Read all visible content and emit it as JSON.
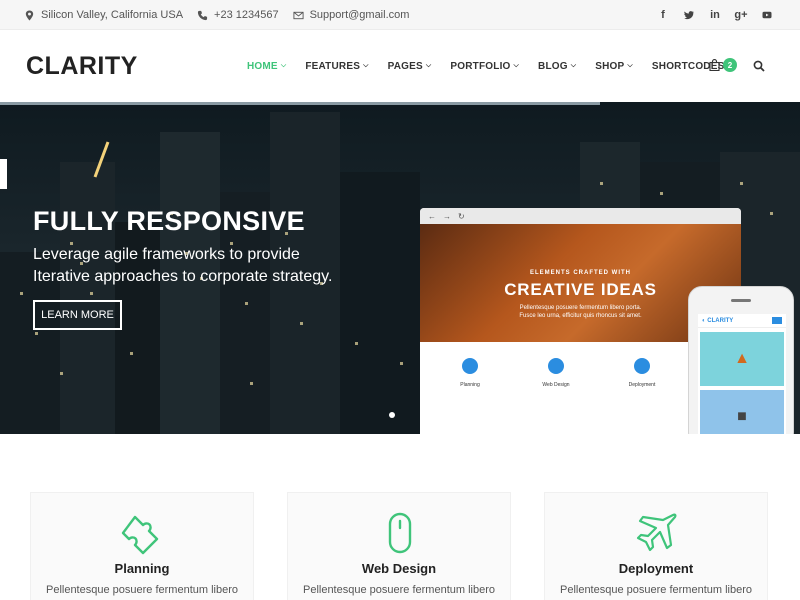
{
  "topbar": {
    "location": "Silicon Valley, California USA",
    "phone": "+23 1234567",
    "email": "Support@gmail.com",
    "social": [
      "facebook-icon",
      "twitter-icon",
      "linkedin-icon",
      "google-plus-icon",
      "youtube-icon"
    ]
  },
  "header": {
    "logo": "CLARITY",
    "nav": [
      {
        "label": "HOME",
        "active": true
      },
      {
        "label": "FEATURES"
      },
      {
        "label": "PAGES"
      },
      {
        "label": "PORTFOLIO"
      },
      {
        "label": "BLOG"
      },
      {
        "label": "SHOP"
      },
      {
        "label": "SHORTCODES"
      }
    ],
    "cart_count": "2"
  },
  "hero": {
    "title": "FULLY RESPONSIVE",
    "subtitle_line1": "Leverage agile frameworks to provide",
    "subtitle_line2": "Iterative approaches to corporate strategy.",
    "button": "LEARN MORE"
  },
  "mockup": {
    "small_heading": "ELEMENTS CRAFTED WITH",
    "big_heading": "CREATIVE IDEAS",
    "desc_line1": "Pellentesque posuere fermentum libero porta.",
    "desc_line2": "Fusce leo urna, efficitur quis rhoncus sit amet.",
    "features": [
      "Planning",
      "Web Design",
      "Deployment"
    ],
    "phone_logo": "CLARITY"
  },
  "cards": [
    {
      "title": "Planning",
      "text": "Pellentesque posuere fermentum libero"
    },
    {
      "title": "Web Design",
      "text": "Pellentesque posuere fermentum libero"
    },
    {
      "title": "Deployment",
      "text": "Pellentesque posuere fermentum libero"
    }
  ],
  "colors": {
    "accent": "#3fc47a",
    "topbar_bg": "#f6f6f6",
    "hero_dark": "#1a262c",
    "mock_blue": "#2b8de0"
  }
}
